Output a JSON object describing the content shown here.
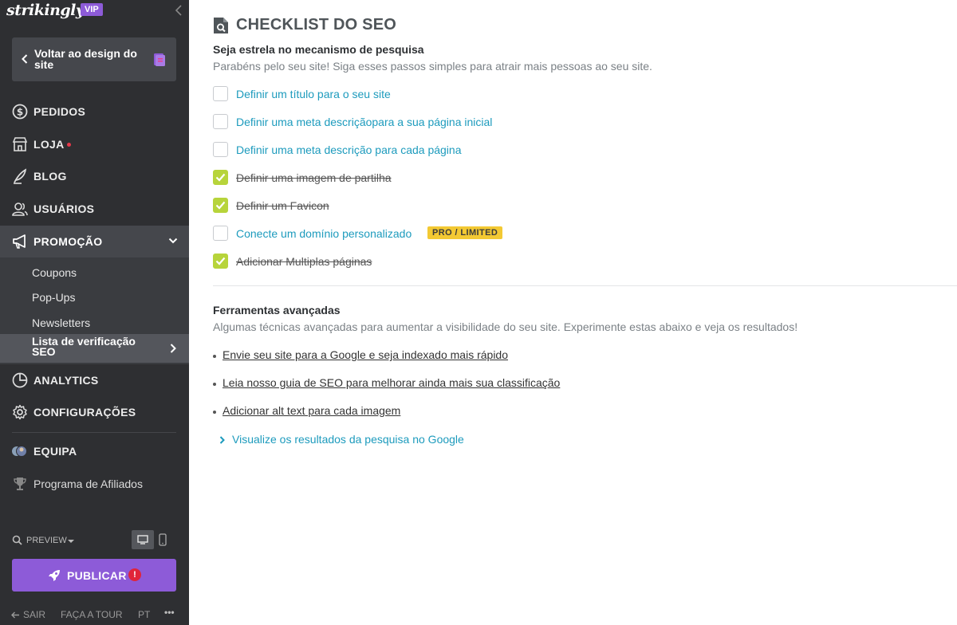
{
  "sidebar": {
    "logo": "strikingly",
    "vip_badge": "VIP",
    "back_label": "Voltar ao design do site",
    "nav": {
      "orders": "PEDIDOS",
      "store": "LOJA",
      "blog": "BLOG",
      "users": "USUÁRIOS",
      "promotion": "PROMOÇÃO",
      "analytics": "ANALYTICS",
      "settings": "CONFIGURAÇÕES",
      "team": "EQUIPA",
      "affiliates": "Programa de Afiliados"
    },
    "promotion_sub": {
      "coupons": "Coupons",
      "popups": "Pop-Ups",
      "newsletters": "Newsletters",
      "seo_checklist": "Lista de verificação SEO"
    },
    "preview_label": "PREVIEW",
    "publish_label": "PUBLICAR",
    "publish_alert": "!",
    "footer": {
      "exit": "SAIR",
      "tour": "FAÇA A TOUR",
      "language": "PT",
      "more": "•••"
    }
  },
  "main": {
    "title": "CHECKLIST DO SEO",
    "section1": {
      "heading": "Seja estrela no mecanismo de pesquisa",
      "subtitle": "Parabéns pelo seu site! Siga esses passos simples para atrair mais pessoas ao seu site."
    },
    "checklist": [
      {
        "label": "Definir um título para o seu site",
        "done": false
      },
      {
        "label": "Definir uma meta descriçãopara a sua página inicial",
        "done": false
      },
      {
        "label": "Definir uma meta descrição para cada página",
        "done": false
      },
      {
        "label": "Definir uma imagem de partilha",
        "done": true
      },
      {
        "label": "Definir um Favicon",
        "done": true
      },
      {
        "label": "Conecte um domínio personalizado",
        "done": false,
        "badge": "PRO / LIMITED"
      },
      {
        "label": "Adicionar Multiplas páginas",
        "done": true
      }
    ],
    "section2": {
      "heading": "Ferramentas avançadas",
      "subtitle": "Algumas técnicas avançadas para aumentar a visibilidade do seu site. Experimente estas abaixo e veja os resultados!"
    },
    "advanced_links": [
      "Envie seu site para a Google e seja indexado mais rápido",
      "Leia nosso guia de SEO para melhorar ainda mais sua classificação",
      "Adicionar alt text para cada imagem"
    ],
    "google_preview_label": "Visualize os resultados da pesquisa no Google"
  },
  "colors": {
    "sidebar_bg": "#2e2f32",
    "accent_purple": "#8d5bd8",
    "link_blue": "#1d9bbd",
    "check_green": "#b7d43b",
    "badge_yellow": "#f3c933",
    "alert_red": "#e0243a"
  }
}
